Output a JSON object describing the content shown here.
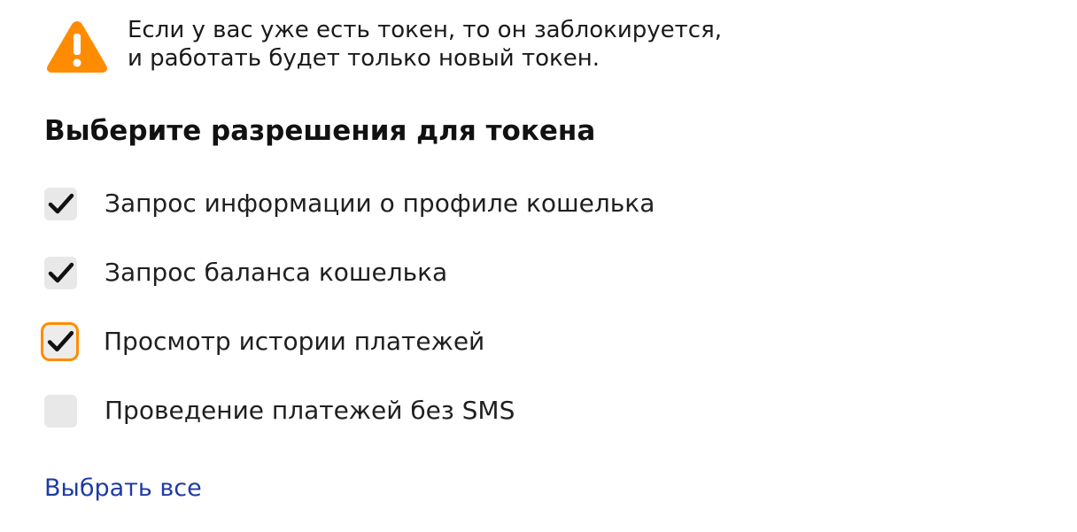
{
  "warning": {
    "icon": "warning-triangle-icon",
    "color": "#ff8c00",
    "line1": "Если у вас уже есть токен, то он заблокируется,",
    "line2": "и работать будет только новый токен."
  },
  "heading": "Выберите разрешения для токена",
  "permissions": [
    {
      "label": "Запрос информации о профиле кошелька",
      "checked": true
    },
    {
      "label": "Запрос баланса кошелька",
      "checked": true
    },
    {
      "label": "Просмотр истории платежей",
      "checked": true,
      "focused": true
    },
    {
      "label": "Проведение платежей без SMS",
      "checked": false
    }
  ],
  "select_all_label": "Выбрать все",
  "colors": {
    "accent": "#ff8c00",
    "link": "#1f3aa5",
    "checkbox_bg": "#e8e8e8"
  }
}
